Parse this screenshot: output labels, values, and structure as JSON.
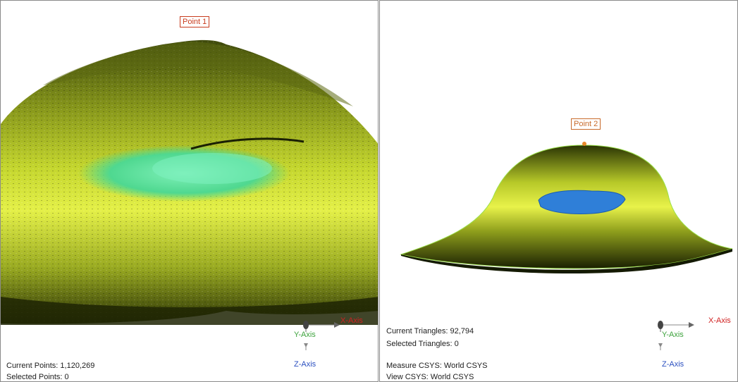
{
  "left_view": {
    "point_label": "Point 1",
    "current_label": "Current Points: 1,120,269",
    "selected_label": "Selected Points: 0"
  },
  "right_view": {
    "point_label": "Point 2",
    "current_label": "Current Triangles: 92,794",
    "selected_label": "Selected Triangles: 0",
    "measure_csys": "Measure CSYS: World CSYS",
    "view_csys": "View CSYS: World CSYS"
  },
  "axes": {
    "x_label": "X-Axis",
    "y_label": "Y-Axis",
    "z_label": "Z-Axis",
    "x_color": "#d02020",
    "y_color": "#3ca23c",
    "z_color": "#2a4fc0"
  },
  "colors": {
    "point_label_color": "#c83c1e",
    "surface_yellow": "#d6e83a",
    "surface_dark": "#2e3808",
    "highlight_green": "#5fe0a0",
    "highlight_blue": "#2f7fd8"
  }
}
